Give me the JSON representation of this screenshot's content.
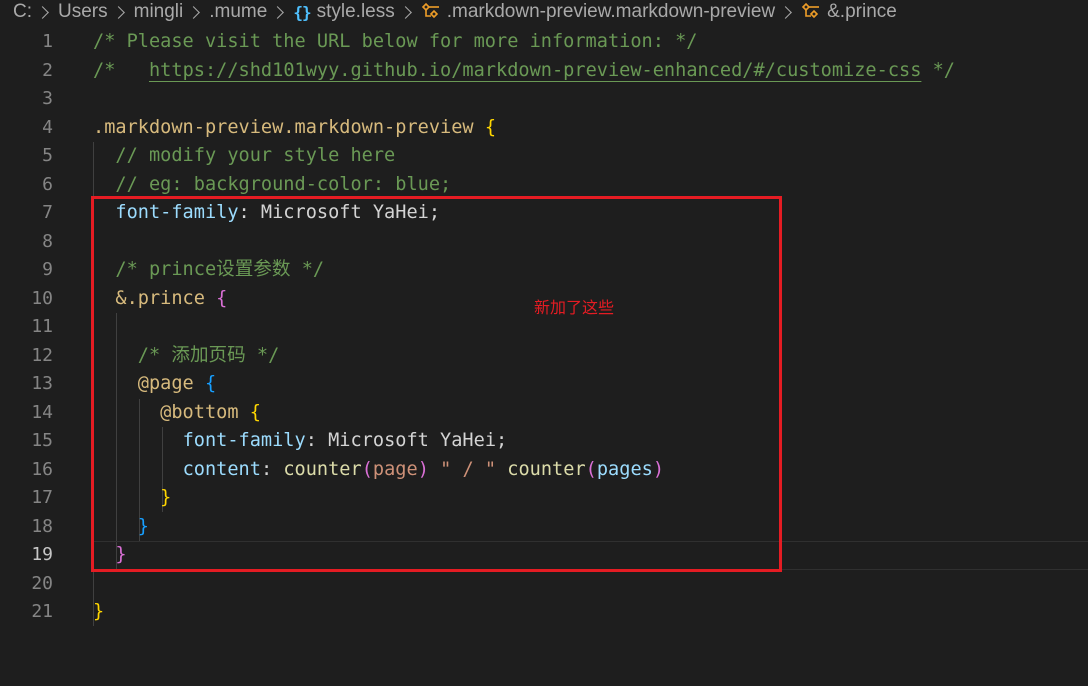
{
  "breadcrumb": {
    "items": [
      {
        "label": "C:",
        "icon": null
      },
      {
        "label": "Users",
        "icon": null
      },
      {
        "label": "mingli",
        "icon": null
      },
      {
        "label": ".mume",
        "icon": null
      },
      {
        "label": "style.less",
        "icon": "curly-braces-icon"
      },
      {
        "label": ".markdown-preview.markdown-preview",
        "icon": "symbol-class-icon"
      },
      {
        "label": "&.prince",
        "icon": "symbol-class-icon"
      }
    ]
  },
  "editor": {
    "active_line": 19,
    "lines": [
      {
        "n": "1",
        "tokens": [
          [
            "c-comment",
            "/* Please visit the URL below for more information: */"
          ]
        ]
      },
      {
        "n": "2",
        "tokens": [
          [
            "c-comment",
            "/*   "
          ],
          [
            "c-link",
            "https://shd101wyy.github.io/markdown-preview-enhanced/#/customize-css"
          ],
          [
            "c-comment",
            " */"
          ]
        ]
      },
      {
        "n": "3",
        "tokens": []
      },
      {
        "n": "4",
        "tokens": [
          [
            "c-sel",
            ".markdown-preview.markdown-preview"
          ],
          [
            "c-txt",
            " "
          ],
          [
            "b1",
            "{"
          ]
        ]
      },
      {
        "n": "5",
        "tokens": [
          [
            "c-comment",
            "  // modify your style here"
          ]
        ]
      },
      {
        "n": "6",
        "tokens": [
          [
            "c-comment",
            "  // eg: background-color: blue;"
          ]
        ]
      },
      {
        "n": "7",
        "tokens": [
          [
            "c-txt",
            "  "
          ],
          [
            "c-prop",
            "font-family"
          ],
          [
            "c-txt",
            ": Microsoft YaHei;"
          ]
        ]
      },
      {
        "n": "8",
        "tokens": []
      },
      {
        "n": "9",
        "tokens": [
          [
            "c-comment",
            "  /* prince设置参数 */"
          ]
        ]
      },
      {
        "n": "10",
        "tokens": [
          [
            "c-txt",
            "  "
          ],
          [
            "c-sel",
            "&.prince"
          ],
          [
            "c-txt",
            " "
          ],
          [
            "b2",
            "{"
          ]
        ]
      },
      {
        "n": "11",
        "tokens": []
      },
      {
        "n": "12",
        "tokens": [
          [
            "c-comment",
            "    /* 添加页码 */"
          ]
        ]
      },
      {
        "n": "13",
        "tokens": [
          [
            "c-txt",
            "    "
          ],
          [
            "c-sel",
            "@page"
          ],
          [
            "c-txt",
            " "
          ],
          [
            "b3",
            "{"
          ]
        ]
      },
      {
        "n": "14",
        "tokens": [
          [
            "c-txt",
            "      "
          ],
          [
            "c-sel",
            "@bottom"
          ],
          [
            "c-txt",
            " "
          ],
          [
            "b1",
            "{"
          ]
        ]
      },
      {
        "n": "15",
        "tokens": [
          [
            "c-txt",
            "        "
          ],
          [
            "c-prop",
            "font-family"
          ],
          [
            "c-txt",
            ": Microsoft YaHei;"
          ]
        ]
      },
      {
        "n": "16",
        "tokens": [
          [
            "c-txt",
            "        "
          ],
          [
            "c-prop",
            "content"
          ],
          [
            "c-txt",
            ": "
          ],
          [
            "c-func",
            "counter"
          ],
          [
            "b2",
            "("
          ],
          [
            "c-str",
            "page"
          ],
          [
            "b2",
            ")"
          ],
          [
            "c-txt",
            " "
          ],
          [
            "c-str",
            "\" / \""
          ],
          [
            "c-txt",
            " "
          ],
          [
            "c-func",
            "counter"
          ],
          [
            "b2",
            "("
          ],
          [
            "c-prop",
            "pages"
          ],
          [
            "b2",
            ")"
          ]
        ]
      },
      {
        "n": "17",
        "tokens": [
          [
            "c-txt",
            "      "
          ],
          [
            "b1",
            "}"
          ]
        ]
      },
      {
        "n": "18",
        "tokens": [
          [
            "c-txt",
            "    "
          ],
          [
            "b3",
            "}"
          ]
        ]
      },
      {
        "n": "19",
        "tokens": [
          [
            "c-txt",
            "  "
          ],
          [
            "b2",
            "}"
          ]
        ]
      },
      {
        "n": "20",
        "tokens": []
      },
      {
        "n": "21",
        "tokens": [
          [
            "b1",
            "}"
          ]
        ]
      }
    ]
  },
  "annotation": {
    "label": "新加了这些",
    "color": "#e51c23"
  },
  "colors": {
    "background": "#1e1e1e",
    "comment": "#6a9955",
    "selector": "#d7ba7d",
    "property": "#9cdcfe",
    "text": "#d4d4d4",
    "string": "#ce9178",
    "function": "#dcdcaa"
  }
}
